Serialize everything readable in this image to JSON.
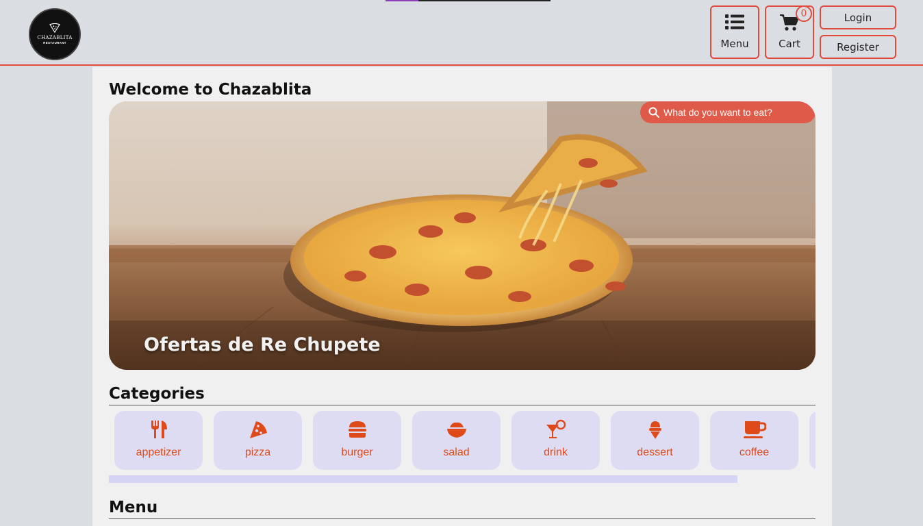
{
  "brand": {
    "name": "CHAZABLITA",
    "tagline": "RESTAURANT"
  },
  "colors": {
    "accent": "#df4a3a",
    "category_bg": "#dddcf3",
    "category_text": "#df4a1a",
    "page_bg": "#dadde1",
    "panel_bg": "#f0f0f1"
  },
  "header": {
    "menu_label": "Menu",
    "menu_icon": "list-icon",
    "cart_label": "Cart",
    "cart_icon": "shopping-cart-icon",
    "cart_count": "0",
    "login_label": "Login",
    "register_label": "Register"
  },
  "page": {
    "welcome": "Welcome to Chazablita"
  },
  "hero": {
    "title": "Ofertas de Re Chupete",
    "search_placeholder": "What do you want to eat?",
    "search_icon": "search-icon"
  },
  "categories": {
    "title": "Categories",
    "items": [
      {
        "label": "appetizer",
        "icon": "utensils-icon"
      },
      {
        "label": "pizza",
        "icon": "pizza-slice-icon"
      },
      {
        "label": "burger",
        "icon": "burger-icon"
      },
      {
        "label": "salad",
        "icon": "salad-bowl-icon"
      },
      {
        "label": "drink",
        "icon": "cocktail-icon"
      },
      {
        "label": "dessert",
        "icon": "ice-cream-icon"
      },
      {
        "label": "coffee",
        "icon": "coffee-mug-icon"
      }
    ]
  },
  "menu": {
    "title": "Menu"
  }
}
